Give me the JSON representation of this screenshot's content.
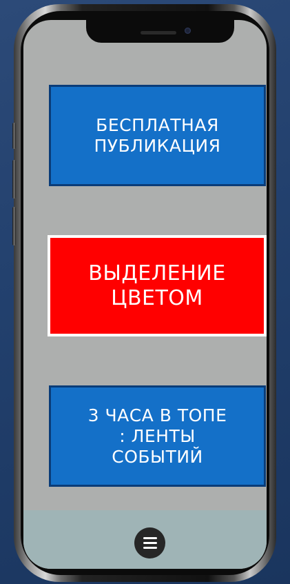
{
  "tiles": [
    {
      "line1": "БЕСПЛАТНАЯ",
      "line2": "ПУБЛИКАЦИЯ"
    },
    {
      "line1": "ВЫДЕЛЕНИЕ",
      "line2": "ЦВЕТОМ"
    },
    {
      "line1": "3 ЧАСА В ТОПЕ",
      "line2": ": ЛЕНТЫ",
      "line3": "СОБЫТИЙ"
    }
  ],
  "colors": {
    "tile_blue": "#1470c8",
    "tile_red": "#ff0000",
    "screen_bg": "#adafae",
    "bottom_bar": "#9fb4b6"
  },
  "bottom_bar": {
    "menu_icon": "hamburger-menu-icon"
  }
}
